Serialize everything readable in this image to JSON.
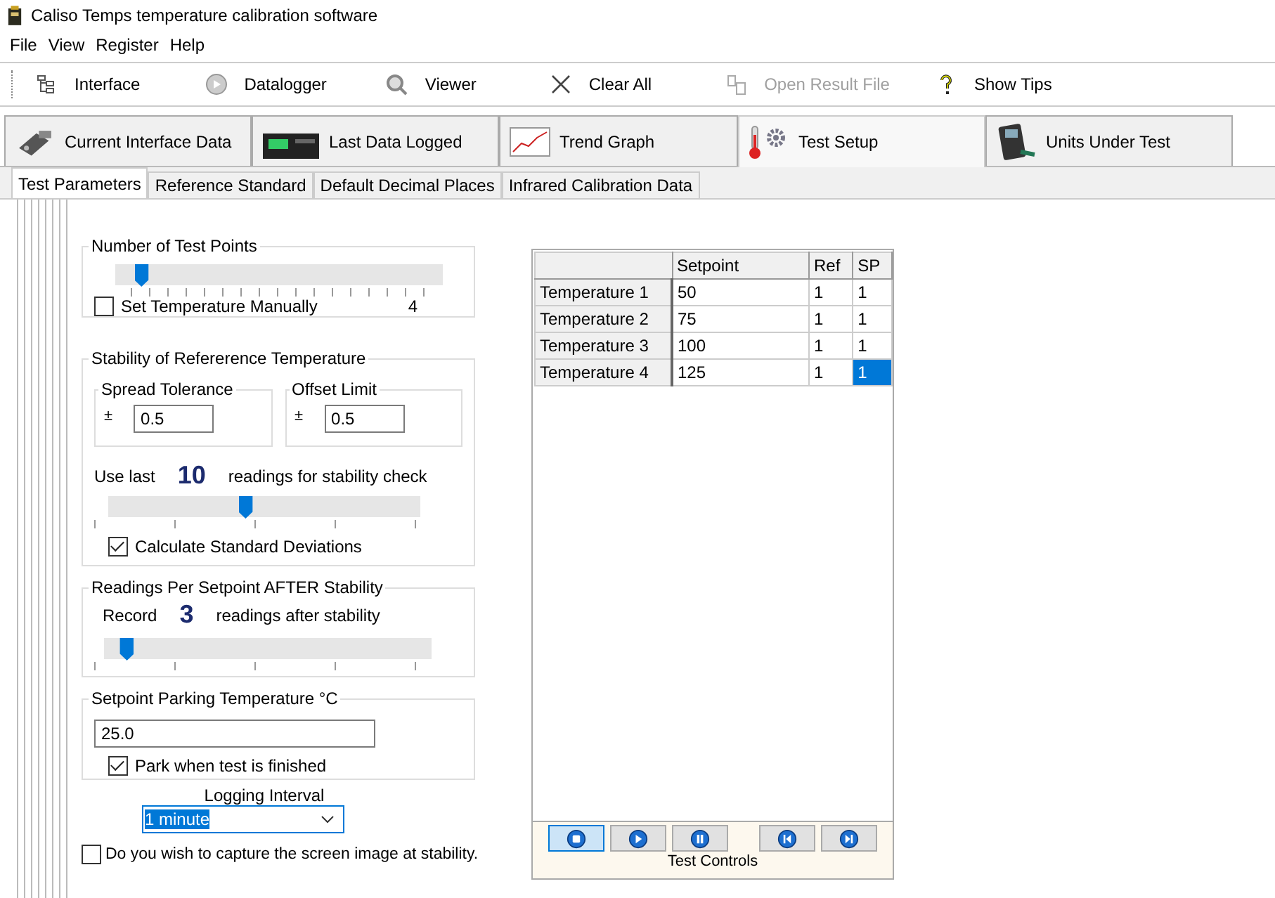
{
  "window": {
    "title": "Caliso Temps temperature calibration software"
  },
  "menu": [
    "File",
    "View",
    "Register",
    "Help"
  ],
  "toolbar": [
    {
      "kind": "tree",
      "label": "Interface",
      "disabled": false
    },
    {
      "kind": "logger",
      "label": "Datalogger",
      "disabled": false
    },
    {
      "kind": "magnifier",
      "label": "Viewer",
      "disabled": false
    },
    {
      "kind": "cross",
      "label": "Clear All",
      "disabled": false
    },
    {
      "kind": "file",
      "label": "Open Result File",
      "disabled": true
    },
    {
      "kind": "question",
      "label": "Show Tips",
      "disabled": false
    }
  ],
  "main_tabs": [
    {
      "kind": "connector",
      "label": "Current Interface Data",
      "selected": false
    },
    {
      "kind": "device",
      "label": "Last Data Logged",
      "selected": false
    },
    {
      "kind": "graph",
      "label": "Trend Graph",
      "selected": false
    },
    {
      "kind": "thermo",
      "label": "Test Setup",
      "selected": true
    },
    {
      "kind": "handheld",
      "label": "Units Under Test",
      "selected": false
    }
  ],
  "sub_tabs": [
    {
      "label": "Test Parameters",
      "selected": true
    },
    {
      "label": "Reference Standard",
      "selected": false
    },
    {
      "label": "Default Decimal Places",
      "selected": false
    },
    {
      "label": "Infrared Calibration Data",
      "selected": false
    }
  ],
  "test_points": {
    "title": "Number of Test Points",
    "level": 0.08,
    "manual_label": "Set Temperature Manually",
    "manual_checked": false,
    "count": "4"
  },
  "stability": {
    "title": "Stability of Refererence Temperature",
    "spread": {
      "title": "Spread Tolerance",
      "sign": "±",
      "value": "0.5"
    },
    "offset": {
      "title": "Offset Limit",
      "sign": "±",
      "value": "0.5"
    },
    "prefix": "Use last",
    "count": "10",
    "suffix": "readings for stability check",
    "level": 0.44,
    "std_label": "Calculate Standard Deviations",
    "std_checked": true
  },
  "readings": {
    "title": "Readings Per Setpoint AFTER Stability",
    "prefix": "Record",
    "count": "3",
    "suffix": "readings after stability",
    "level": 0.07
  },
  "parking": {
    "title": "Setpoint Parking Temperature °C",
    "value": "25.0",
    "park_label": "Park when test is finished",
    "park_checked": true
  },
  "logging": {
    "title": "Logging Interval",
    "value": "1 minute"
  },
  "capture": {
    "label": "Do you wish to capture the screen image at stability.",
    "checked": false
  },
  "table": {
    "columns": [
      "Setpoint",
      "Ref",
      "SP"
    ],
    "rows": [
      {
        "header": "Temperature 1",
        "cells": [
          {
            "text": "50",
            "selected": false
          },
          {
            "text": "1",
            "selected": false
          },
          {
            "text": "1",
            "selected": false
          }
        ]
      },
      {
        "header": "Temperature 2",
        "cells": [
          {
            "text": "75",
            "selected": false
          },
          {
            "text": "1",
            "selected": false
          },
          {
            "text": "1",
            "selected": false
          }
        ]
      },
      {
        "header": "Temperature 3",
        "cells": [
          {
            "text": "100",
            "selected": false
          },
          {
            "text": "1",
            "selected": false
          },
          {
            "text": "1",
            "selected": false
          }
        ]
      },
      {
        "header": "Temperature 4",
        "cells": [
          {
            "text": "125",
            "selected": false
          },
          {
            "text": "1",
            "selected": false
          },
          {
            "text": "1",
            "selected": true
          }
        ]
      }
    ]
  },
  "controls": {
    "label": "Test Controls",
    "buttons": [
      {
        "kind": "stop",
        "selected": true
      },
      {
        "kind": "play",
        "selected": false
      },
      {
        "kind": "pause",
        "selected": false
      },
      {
        "kind": "back",
        "selected": false
      },
      {
        "kind": "forward",
        "selected": false
      }
    ]
  }
}
